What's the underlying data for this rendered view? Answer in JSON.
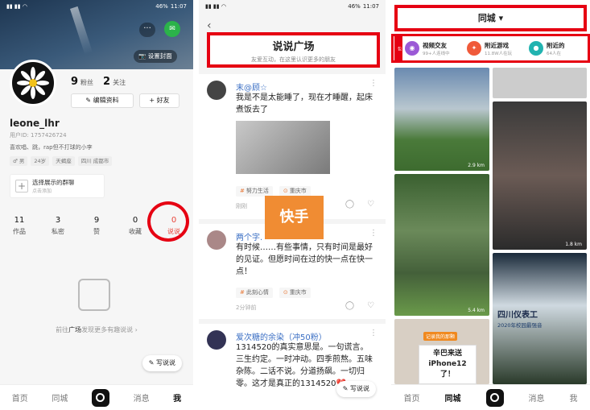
{
  "status": {
    "time": "11:07",
    "battery": "46%"
  },
  "profile": {
    "set_cover": "设置封面",
    "fans_count": "9",
    "fans_label": "粉丝",
    "follow_count": "2",
    "follow_label": "关注",
    "edit_label": "编辑资料",
    "add_friend_label": "好友",
    "username": "leone_lhr",
    "user_id": "用户ID: 1757426724",
    "bio": "喜欢唱、跳，rap但不打球的小李",
    "tags": [
      "男",
      "24岁",
      "天蝎座",
      "四川 成都市"
    ],
    "group_title": "选择展示的群聊",
    "group_sub": "点击添加",
    "tabs": [
      {
        "count": "11",
        "label": "作品"
      },
      {
        "count": "3",
        "label": "私密"
      },
      {
        "count": "9",
        "label": "赞"
      },
      {
        "count": "0",
        "label": "收藏"
      },
      {
        "count": "0",
        "label": "说说"
      }
    ],
    "empty_prefix": "前往",
    "empty_link": "广场",
    "empty_suffix": "发现更多有趣说说 ›",
    "post_button": "写说说"
  },
  "nav1": [
    "首页",
    "同城",
    "消息",
    "我"
  ],
  "square": {
    "title": "说说广场",
    "subtitle": "友爱互动，在这里认识更多的朋友",
    "watermark": "快手",
    "posts": [
      {
        "name": "末@顾☆",
        "text": "我是不是太能睡了，现在才睡醒，起床煮饭去了",
        "tags": [
          "努力生活",
          "重庆市"
        ],
        "time": "刚刚"
      },
      {
        "name": "两个字.",
        "text": "有时候……有些事情，只有时间是最好的见证。但愿时间在过的快一点在快一点！",
        "tags": [
          "此刻心情",
          "重庆市"
        ],
        "time": "2分钟前"
      },
      {
        "name": "爱次糖的余染（冲50粉）",
        "text": "1314520的真实意思是。一句谎言。三生约定。一时冲动。四季煎熬。五味杂陈。二话不说。分道扬飙。一切归零。这才是真正的1314520💔"
      }
    ],
    "post_button": "写说说"
  },
  "city": {
    "title": "同城",
    "side_tag": "包",
    "categories": [
      {
        "name": "视频交友",
        "count": "99+人连线中",
        "color": "#9b59d6"
      },
      {
        "name": "附近游戏",
        "count": "11.8W人在玩",
        "color": "#f05a3a"
      },
      {
        "name": "附近的",
        "count": "64人在",
        "color": "#22b3b0"
      }
    ],
    "distances": [
      "2.9 km",
      "5.4 km",
      "1.8 km"
    ],
    "banner_top": "记录我的那颗",
    "banner_text": "辛巴来送iPhone12了！",
    "stage_text": "四川仪表工",
    "stage_sub": "2020年校园最强音"
  },
  "nav3": [
    "首页",
    "同城",
    "消息",
    "我"
  ]
}
